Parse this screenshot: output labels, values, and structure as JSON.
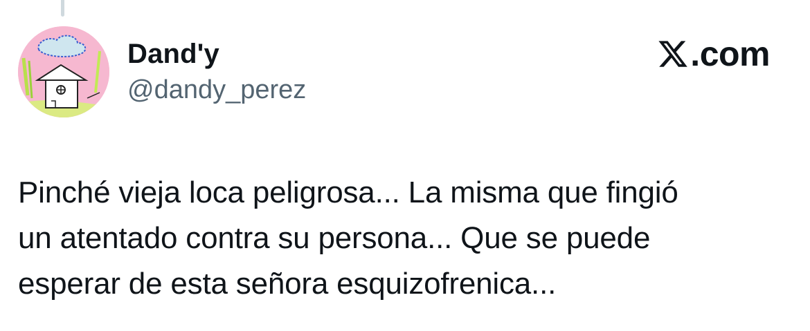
{
  "tweet": {
    "author": {
      "display_name": "Dand'y",
      "handle": "@dandy_perez",
      "avatar_icon": "house-drawing-avatar"
    },
    "brand": {
      "icon": "x-logo-icon",
      "text": ".com"
    },
    "text": "Pinché vieja loca peligrosa... La misma que fingió\nun atentado contra su persona... Que se puede\nesperar de esta señora esquizofrenica..."
  },
  "colors": {
    "text_primary": "#0f1419",
    "text_secondary": "#536471",
    "thread_line": "#cfd9de",
    "avatar_background": "#f6b8d0"
  }
}
